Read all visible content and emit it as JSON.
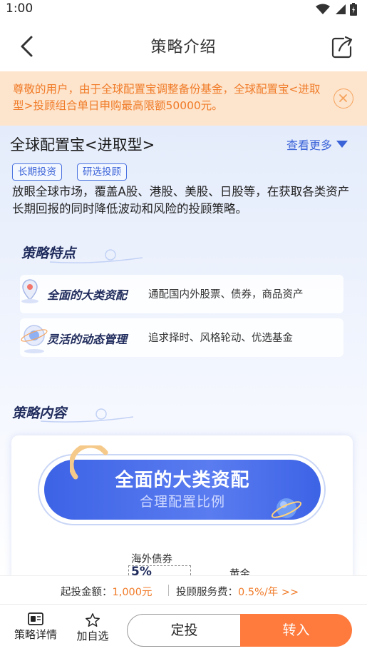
{
  "status": {
    "time": "1:00"
  },
  "nav": {
    "title": "策略介绍"
  },
  "notice": {
    "text": "尊敬的用户，由于全球配置宝调整备份基金，全球配置宝<进取型>投顾组合单日申购最高限额50000元。"
  },
  "fund": {
    "name": "全球配置宝<进取型>",
    "more": "查看更多",
    "tags": [
      "长期投资",
      "研选投顾"
    ],
    "intro": "放眼全球市场，覆盖A股、港股、美股、日股等，在获取各类资产长期回报的同时降低波动和风险的投顾策略。"
  },
  "features": {
    "title": "策略特点",
    "items": [
      {
        "name": "全面的大类资配",
        "desc": "通配国内外股票、债券，商品资产",
        "icon": "map-pin-icon"
      },
      {
        "name": "灵活的动态管理",
        "desc": "追求择时、风格轮动、优选基金",
        "icon": "planet-icon"
      }
    ]
  },
  "content": {
    "title": "策略内容",
    "pill_title": "全面的大类资配",
    "pill_sub": "合理配置比例",
    "chart_label_1": "海外债券",
    "chart_value_1": "5%",
    "chart_label_2": "黄金"
  },
  "info": {
    "min_label": "起投金额：",
    "min_value": "1,000元",
    "fee_label": "投顾服务费：",
    "fee_value": "0.5%/年 >>"
  },
  "tabs": {
    "detail": "策略详情",
    "favorite": "加自选",
    "dingtou": "定投",
    "zhuanru": "转入"
  },
  "colors": {
    "accent": "#3b63d8",
    "orange": "#ff7a3d",
    "notice_bg": "#fde4cc"
  }
}
